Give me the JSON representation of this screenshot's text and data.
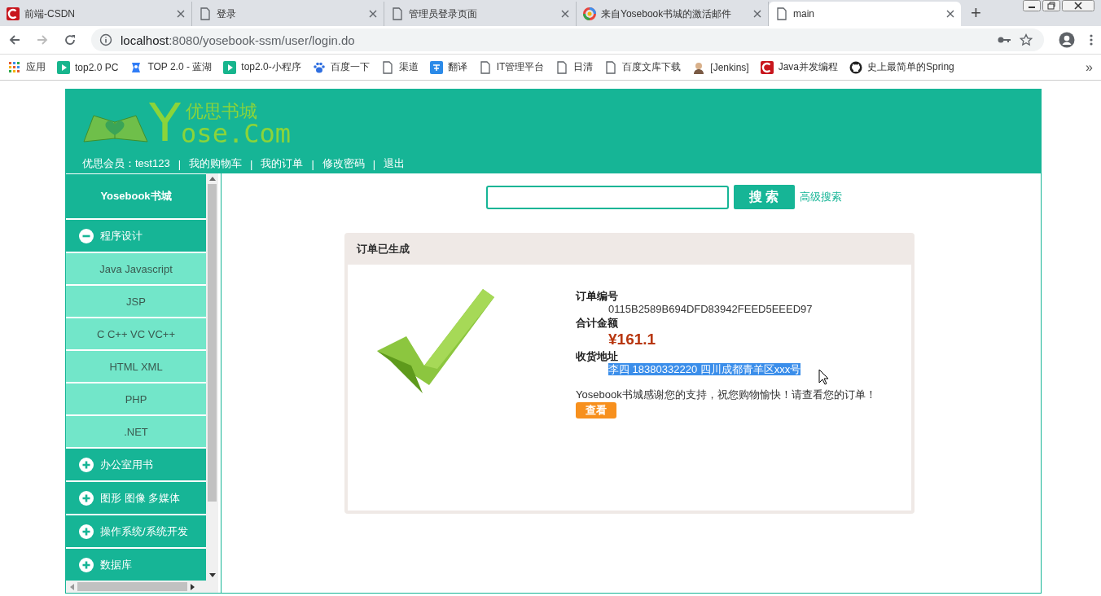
{
  "browser": {
    "tabs": [
      {
        "title": "前端-CSDN",
        "kind": "csdn",
        "selected": false
      },
      {
        "title": "登录",
        "kind": "page",
        "selected": false
      },
      {
        "title": "管理员登录页面",
        "kind": "page",
        "selected": false
      },
      {
        "title": "来自Yosebook书城的激活邮件",
        "kind": "ring",
        "selected": false
      },
      {
        "title": "main",
        "kind": "page",
        "selected": true
      }
    ],
    "new_tab": "+",
    "address": {
      "host": "localhost",
      "rest": ":8080/yosebook-ssm/user/login.do"
    },
    "bookmarks": [
      {
        "label": "应用",
        "kind": "apps"
      },
      {
        "label": "top2.0 PC",
        "kind": "play"
      },
      {
        "label": "TOP 2.0 - 蓝湖",
        "kind": "bird"
      },
      {
        "label": "top2.0-小程序",
        "kind": "play"
      },
      {
        "label": "百度一下",
        "kind": "paw"
      },
      {
        "label": "渠道",
        "kind": "page"
      },
      {
        "label": "翻译",
        "kind": "translate"
      },
      {
        "label": "IT管理平台",
        "kind": "page"
      },
      {
        "label": "日清",
        "kind": "page"
      },
      {
        "label": "百度文库下载",
        "kind": "page"
      },
      {
        "label": "[Jenkins]",
        "kind": "person"
      },
      {
        "label": "Java并发编程",
        "kind": "csdn"
      },
      {
        "label": "史上最简单的Spring",
        "kind": "github"
      }
    ],
    "bookmarks_more": "»"
  },
  "site": {
    "logo": {
      "name": "优思书城",
      "letter": "Y",
      "domain": "ose.Com"
    },
    "nav": {
      "items": [
        "优思会员：test123",
        "我的购物车",
        "我的订单",
        "修改密码",
        "退出"
      ],
      "separator": "|"
    },
    "sidebar": {
      "title": "Yosebook书城",
      "categories": [
        {
          "label": "程序设计",
          "expanded": true,
          "children": [
            "Java Javascript",
            "JSP",
            "C C++ VC VC++",
            "HTML XML",
            "PHP",
            ".NET"
          ]
        },
        {
          "label": "办公室用书",
          "expanded": false
        },
        {
          "label": "图形 图像 多媒体",
          "expanded": false
        },
        {
          "label": "操作系统/系统开发",
          "expanded": false
        },
        {
          "label": "数据库",
          "expanded": false
        }
      ]
    },
    "search": {
      "button": "搜 索",
      "advanced_link": "高级搜索"
    },
    "order": {
      "heading": "订单已生成",
      "fields": [
        {
          "label": "订单编号",
          "value": "0115B2589B694DFD83942FEED5EEED97",
          "kind": "plain",
          "highlighted": false
        },
        {
          "label": "合计金额",
          "value": "¥161.1",
          "kind": "price",
          "highlighted": false
        },
        {
          "label": "收货地址",
          "value": "李四 18380332220 四川成都青羊区xxx号",
          "kind": "plain",
          "highlighted": true
        }
      ],
      "message": "Yosebook书城感谢您的支持，祝您购物愉快！请查看您的订单！",
      "button": "查看"
    }
  }
}
